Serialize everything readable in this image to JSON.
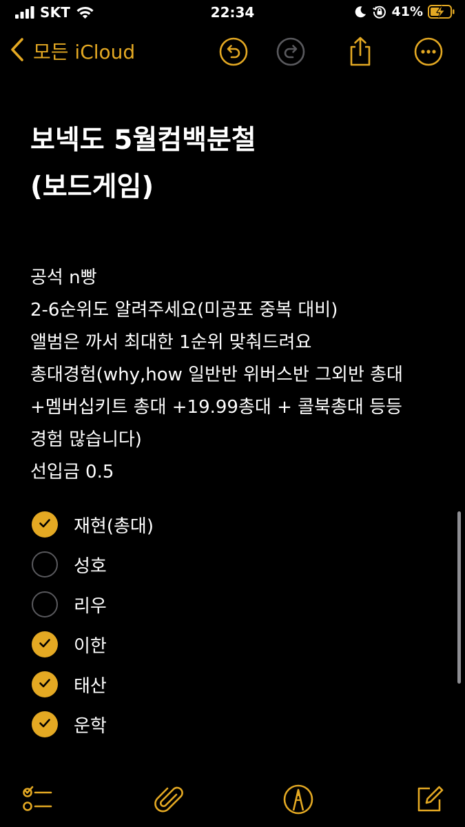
{
  "status_bar": {
    "carrier": "SKT",
    "time": "22:34",
    "battery": "41%"
  },
  "nav": {
    "back_label": "모든 iCloud"
  },
  "note": {
    "title_lines": [
      "보넥도 5월컴백분철",
      "(보드게임)"
    ],
    "body_lines": [
      "공석 n빵",
      "2-6순위도 알려주세요(미공포 중복 대비)",
      "앨범은 까서 최대한 1순위 맞춰드려요",
      "총대경험(why,how 일반반 위버스반 그외반 총대",
      "+멤버십키트 총대 +19.99총대 + 콜북총대 등등",
      "경험 많습니다)",
      "선입금 0.5"
    ],
    "checklist": [
      {
        "label": "재현(총대)",
        "checked": true
      },
      {
        "label": "성호",
        "checked": false
      },
      {
        "label": "리우",
        "checked": false
      },
      {
        "label": "이한",
        "checked": true
      },
      {
        "label": "태산",
        "checked": true
      },
      {
        "label": "운학",
        "checked": true
      }
    ]
  },
  "colors": {
    "accent": "#e4a923",
    "background": "#000000",
    "text": "#ffffff",
    "unchecked_ring": "#5a5a5e",
    "disabled_icon": "#5a5a5e"
  },
  "icons": {
    "status": [
      "signal-icon",
      "wifi-icon",
      "moon-icon",
      "orientation-lock-icon",
      "battery-charging-icon"
    ],
    "nav": [
      "chevron-left-icon",
      "undo-icon",
      "redo-icon",
      "share-icon",
      "more-icon"
    ],
    "toolbar": [
      "checklist-icon",
      "paperclip-icon",
      "markup-pen-icon",
      "compose-icon"
    ]
  }
}
